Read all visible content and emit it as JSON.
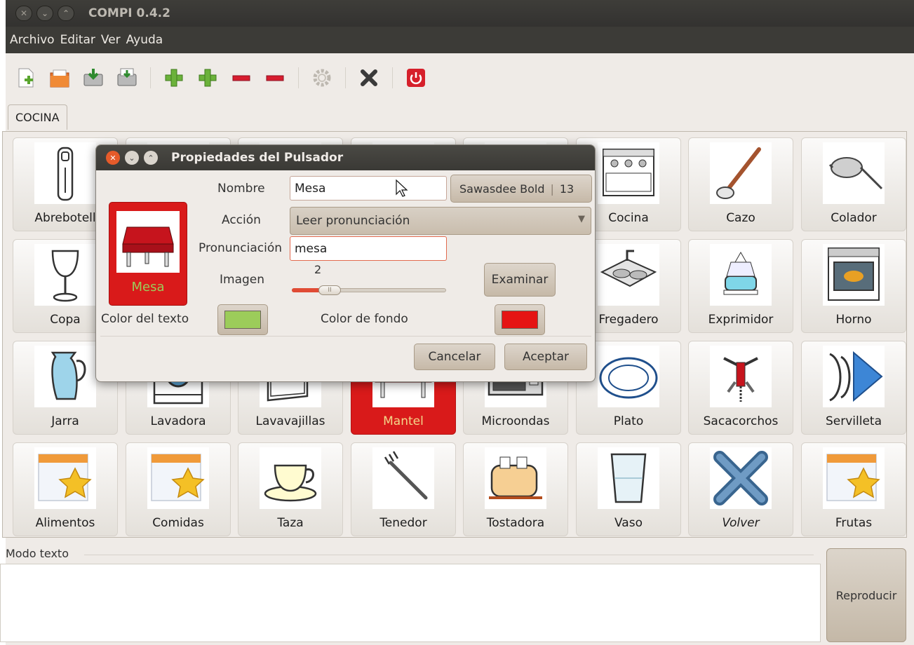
{
  "window": {
    "title": "COMPI 0.4.2"
  },
  "menu": [
    "Archivo",
    "Editar",
    "Ver",
    "Ayuda"
  ],
  "toolbar": {
    "icons": [
      "new-document-icon",
      "open-folder-icon",
      "save-icon",
      "save-as-icon",
      "add-icon",
      "add-icon",
      "remove-icon",
      "remove-icon",
      "settings-icon",
      "delete-icon",
      "quit-icon"
    ]
  },
  "tabs": [
    {
      "label": "COCINA"
    }
  ],
  "grid": [
    {
      "label": "Abrebotell",
      "icon": "bottle-opener-icon"
    },
    {
      "label": "",
      "icon": ""
    },
    {
      "label": "",
      "icon": ""
    },
    {
      "label": "",
      "icon": ""
    },
    {
      "label": "",
      "icon": ""
    },
    {
      "label": "Cocina",
      "icon": "stove-icon"
    },
    {
      "label": "Cazo",
      "icon": "ladle-icon"
    },
    {
      "label": "Colador",
      "icon": "strainer-icon"
    },
    {
      "label": "Copa",
      "icon": "wine-glass-icon"
    },
    {
      "label": "",
      "icon": ""
    },
    {
      "label": "",
      "icon": ""
    },
    {
      "label": "",
      "icon": ""
    },
    {
      "label": "",
      "icon": ""
    },
    {
      "label": "Fregadero",
      "icon": "sink-icon"
    },
    {
      "label": "Exprimidor",
      "icon": "juicer-icon"
    },
    {
      "label": "Horno",
      "icon": "oven-icon"
    },
    {
      "label": "Jarra",
      "icon": "jug-icon"
    },
    {
      "label": "Lavadora",
      "icon": "washing-machine-icon"
    },
    {
      "label": "Lavavajillas",
      "icon": "dishwasher-icon"
    },
    {
      "label": "Mantel",
      "icon": "tablecloth-icon",
      "selected": true
    },
    {
      "label": "Microondas",
      "icon": "microwave-icon"
    },
    {
      "label": "Plato",
      "icon": "plate-icon"
    },
    {
      "label": "Sacacorchos",
      "icon": "corkscrew-icon"
    },
    {
      "label": "Servilleta",
      "icon": "napkin-icon"
    },
    {
      "label": "Alimentos",
      "icon": "calendar-star-icon"
    },
    {
      "label": "Comidas",
      "icon": "calendar-star-icon"
    },
    {
      "label": "Taza",
      "icon": "cup-icon"
    },
    {
      "label": "Tenedor",
      "icon": "fork-icon"
    },
    {
      "label": "Tostadora",
      "icon": "toaster-icon"
    },
    {
      "label": "Vaso",
      "icon": "glass-icon"
    },
    {
      "label": "Volver",
      "icon": "back-x-icon",
      "italic": true
    },
    {
      "label": "Frutas",
      "icon": "calendar-star-icon"
    }
  ],
  "textmode": {
    "legend": "Modo texto",
    "value": "",
    "play_label": "Reproducir"
  },
  "dialog": {
    "title": "Propiedades del Pulsador",
    "preview_label": "Mesa",
    "nombre_label": "Nombre",
    "nombre_value": "Mesa",
    "font_name": "Sawasdee Bold",
    "font_size": "13",
    "accion_label": "Acción",
    "accion_value": "Leer pronunciación",
    "pronunciacion_label": "Pronunciación",
    "pronunciacion_value": "mesa",
    "imagen_label": "Imagen",
    "imagen_value": "2",
    "imagen_slider_fraction": 0.2,
    "examinar_label": "Examinar",
    "color_texto_label": "Color del texto",
    "color_texto": "#9ccc5a",
    "color_fondo_label": "Color de fondo",
    "color_fondo": "#e51414",
    "cancel_label": "Cancelar",
    "accept_label": "Aceptar"
  }
}
